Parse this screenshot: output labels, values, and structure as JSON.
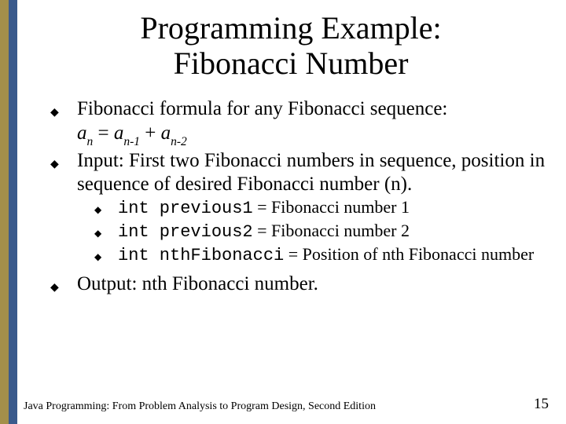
{
  "title_line1": "Programming Example:",
  "title_line2": "Fibonacci Number",
  "bullets": {
    "b1": "Fibonacci formula for any Fibonacci sequence:",
    "formula_plain": "an = an-1 + an-2",
    "b2": "Input: First two Fibonacci numbers in sequence, position in sequence of desired Fibonacci number (n).",
    "sub": {
      "s1_code": "int previous1",
      "s1_rest": " = Fibonacci number 1",
      "s2_code": "int previous2",
      "s2_rest": " = Fibonacci number 2",
      "s3_code": "int nthFibonacci",
      "s3_rest": " = Position of nth Fibonacci number"
    },
    "b3": "Output: nth Fibonacci number."
  },
  "formula": {
    "a": "a",
    "n": "n",
    "eq": " = ",
    "n1": "n-1",
    "plus": " + ",
    "n2": "n-2"
  },
  "footer": {
    "left": "Java Programming: From Problem Analysis to Program Design, Second Edition",
    "right": "15"
  },
  "glyph": "◆"
}
